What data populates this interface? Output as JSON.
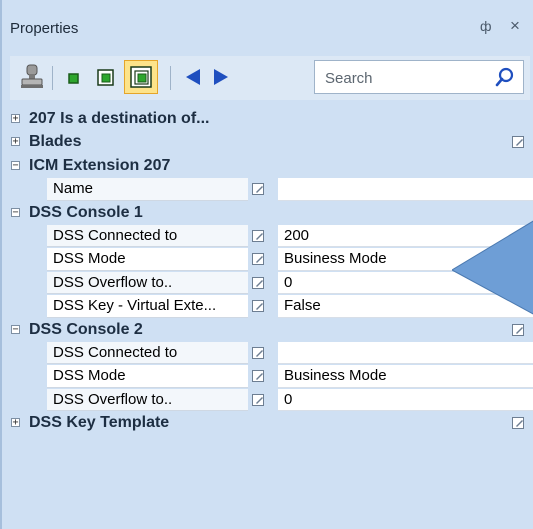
{
  "panel": {
    "title": "Properties",
    "pin_glyph": "ф",
    "close_glyph": "×"
  },
  "toolbar": {
    "search_placeholder": "Search",
    "icons": [
      "property-pages-icon",
      "small-square-icon",
      "medium-square-icon",
      "large-square-icon-selected",
      "back-arrow-icon",
      "forward-arrow-icon",
      "search-icon"
    ]
  },
  "grid": {
    "rows": [
      {
        "kind": "category",
        "expanded": false,
        "label": "207 Is a destination of...",
        "has_edit": false
      },
      {
        "kind": "category",
        "expanded": false,
        "label": "Blades",
        "has_edit": true
      },
      {
        "kind": "category",
        "expanded": true,
        "label": "ICM Extension 207",
        "has_edit": false
      },
      {
        "kind": "property",
        "name": "Name",
        "value": ""
      },
      {
        "kind": "category",
        "expanded": true,
        "label": "DSS Console 1",
        "has_edit": false
      },
      {
        "kind": "property",
        "name": "DSS Connected to",
        "value": "200"
      },
      {
        "kind": "property",
        "name": "DSS Mode",
        "value": "Business Mode"
      },
      {
        "kind": "property",
        "name": "DSS Overflow to..",
        "value": "0"
      },
      {
        "kind": "property",
        "name": "DSS Key - Virtual Exte...",
        "value": "False"
      },
      {
        "kind": "category",
        "expanded": true,
        "label": "DSS Console 2",
        "has_edit": true
      },
      {
        "kind": "property",
        "name": "DSS Connected to",
        "value": ""
      },
      {
        "kind": "property",
        "name": "DSS Mode",
        "value": "Business Mode"
      },
      {
        "kind": "property",
        "name": "DSS Overflow to..",
        "value": "0"
      },
      {
        "kind": "category",
        "expanded": false,
        "label": "DSS Key Template",
        "has_edit": true
      }
    ]
  },
  "colors": {
    "panel_bg": "#cfe0f3",
    "callout_fill": "#6e9ed6",
    "arrow_blue": "#1f4fbf"
  }
}
